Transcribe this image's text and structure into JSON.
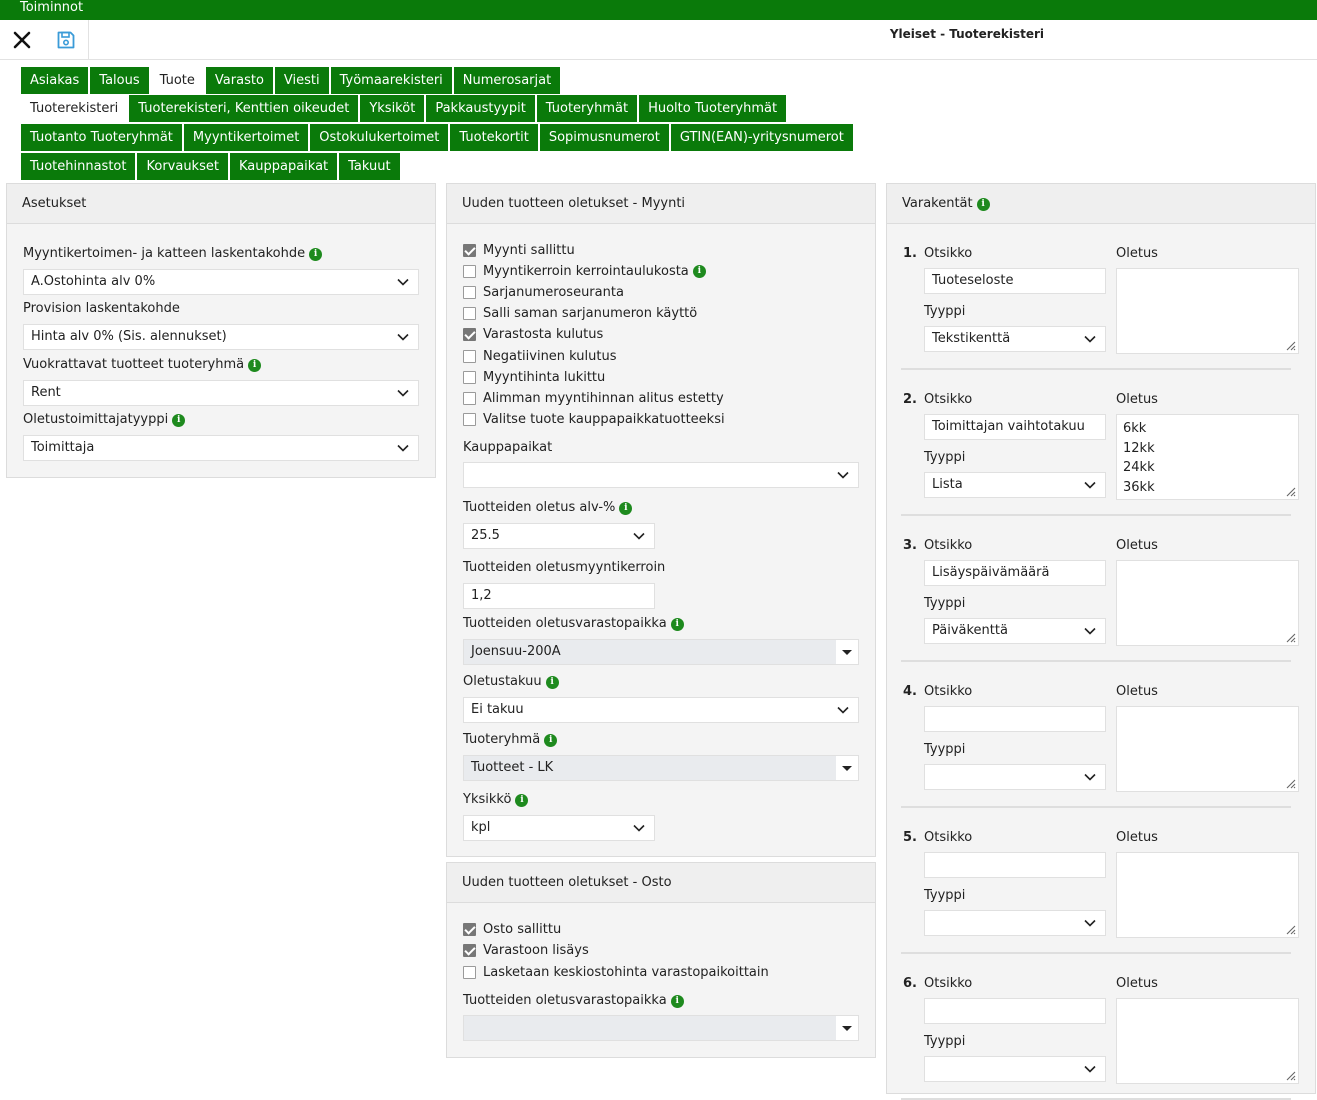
{
  "menubar": {
    "label": "Toiminnot"
  },
  "toolbar": {
    "title": "Yleiset - Tuoterekisteri",
    "close_icon": "close-icon",
    "save_icon": "save-icon"
  },
  "tabs": {
    "row1": [
      "Asiakas",
      "Talous",
      "Tuote",
      "Varasto",
      "Viesti",
      "Työmaarekisteri",
      "Numerosarjat"
    ],
    "row2": [
      "Tuoterekisteri",
      "Tuoterekisteri, Kenttien oikeudet",
      "Yksiköt",
      "Pakkaustyypit",
      "Tuoteryhmät",
      "Huolto Tuoteryhmät"
    ],
    "row3": [
      "Tuotanto Tuoteryhmät",
      "Myyntikertoimet",
      "Ostokulukertoimet",
      "Tuotekortit",
      "Sopimusnumerot",
      "GTIN(EAN)-yritysnumerot"
    ],
    "row4": [
      "Tuotehinnastot",
      "Korvaukset",
      "Kauppapaikat",
      "Takuut"
    ],
    "active_row1": "Tuote",
    "active_row2": "Tuoterekisteri"
  },
  "settings": {
    "title": "Asetukset",
    "f1_label": "Myyntikertoimen- ja katteen laskentakohde",
    "f1_value": "A.Ostohinta alv 0%",
    "f2_label": "Provision laskentakohde",
    "f2_value": "Hinta alv 0% (Sis. alennukset)",
    "f3_label": "Vuokrattavat tuotteet tuoteryhmä",
    "f3_value": "Rent",
    "f4_label": "Oletustoimittajatyyppi",
    "f4_value": "Toimittaja"
  },
  "sales": {
    "title": "Uuden tuotteen oletukset - Myynti",
    "checkboxes": [
      {
        "label": "Myynti sallittu",
        "checked": true,
        "info": false
      },
      {
        "label": "Myyntikerroin kerrointaulukosta",
        "checked": false,
        "info": true
      },
      {
        "label": "Sarjanumeroseuranta",
        "checked": false,
        "info": false
      },
      {
        "label": "Salli saman sarjanumeron käyttö",
        "checked": false,
        "info": false
      },
      {
        "label": "Varastosta kulutus",
        "checked": true,
        "info": false
      },
      {
        "label": "Negatiivinen kulutus",
        "checked": false,
        "info": false
      },
      {
        "label": "Myyntihinta lukittu",
        "checked": false,
        "info": false
      },
      {
        "label": "Alimman myyntihinnan alitus estetty",
        "checked": false,
        "info": false
      },
      {
        "label": "Valitse tuote kauppapaikkatuotteeksi",
        "checked": false,
        "info": false
      }
    ],
    "marketplaces_label": "Kauppapaikat",
    "marketplaces_value": "",
    "vat_label": "Tuotteiden oletus alv-%",
    "vat_value": "25.5",
    "multiplier_label": "Tuotteiden oletusmyyntikerroin",
    "multiplier_value": "1,2",
    "storage_label": "Tuotteiden oletusvarastopaikka",
    "storage_value": "Joensuu-200A",
    "warranty_label": "Oletustakuu",
    "warranty_value": "Ei takuu",
    "group_label": "Tuoteryhmä",
    "group_value": "Tuotteet - LK",
    "unit_label": "Yksikkö",
    "unit_value": "kpl"
  },
  "purchase": {
    "title": "Uuden tuotteen oletukset - Osto",
    "checkboxes": [
      {
        "label": "Osto sallittu",
        "checked": true
      },
      {
        "label": "Varastoon lisäys",
        "checked": true
      },
      {
        "label": "Lasketaan keskiostohinta varastopaikoittain",
        "checked": false
      }
    ],
    "storage_label": "Tuotteiden oletusvarastopaikka",
    "storage_value": ""
  },
  "reserve": {
    "title": "Varakentät",
    "header_label": "Otsikko",
    "default_label": "Oletus",
    "type_label": "Tyyppi",
    "fields": [
      {
        "num": "1.",
        "title": "Tuoteseloste",
        "type": "Tekstikenttä",
        "default": ""
      },
      {
        "num": "2.",
        "title": "Toimittajan vaihtotakuu",
        "type": "Lista",
        "default": "6kk\n12kk\n24kk\n36kk"
      },
      {
        "num": "3.",
        "title": "Lisäyspäivämäärä",
        "type": "Päiväkenttä",
        "default": ""
      },
      {
        "num": "4.",
        "title": "",
        "type": "",
        "default": ""
      },
      {
        "num": "5.",
        "title": "",
        "type": "",
        "default": ""
      },
      {
        "num": "6.",
        "title": "",
        "type": "",
        "default": ""
      }
    ]
  }
}
